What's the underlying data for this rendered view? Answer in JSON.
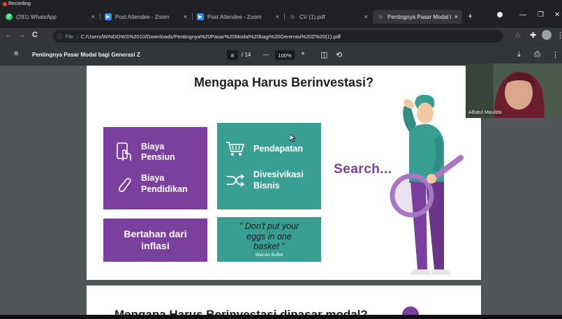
{
  "recording": {
    "label": "Recording"
  },
  "tabs": [
    {
      "title": "(281) WhatsApp",
      "icon": "whatsapp-icon",
      "color": "#25d366",
      "close": "×"
    },
    {
      "title": "Post Attendee - Zoom",
      "icon": "zoom-icon",
      "color": "#2d8cff",
      "close": "×"
    },
    {
      "title": "Post Attendee - Zoom",
      "icon": "zoom-icon",
      "color": "#2d8cff",
      "close": "×"
    },
    {
      "title": "CV (1).pdf",
      "icon": "globe-icon",
      "color": "#9aa0a6",
      "close": "×"
    },
    {
      "title": "Pentingnya Pasar Modal bag",
      "icon": "globe-icon",
      "color": "#9aa0a6",
      "close": "×"
    }
  ],
  "new_tab": "+",
  "address": {
    "file_label": "File",
    "url": "C:/Users/WINDOWS%2010/Downloads/Pentingnya%20Pasar%20Modal%20bagi%20Generasi%20Z%20(1).pdf"
  },
  "pdf_toolbar": {
    "title": "Pentingnya Pasar Modal bagi Generasi Z",
    "page": "8",
    "total": "/ 14",
    "zoom": "100%",
    "minus": "—",
    "plus": "+"
  },
  "slide": {
    "title": "Mengapa Harus Berinvestasi?",
    "card1": {
      "line1": "Biaya\nPensiun",
      "line2": "Biaya\nPendidikan"
    },
    "card2": {
      "line1": "Pendapatan",
      "line2": "Divesivikasi\nBisnis"
    },
    "card3": {
      "text": "Bertahan dari\ninflasi"
    },
    "card4": {
      "quote": "\" Don't put your\neggs in one\nbasket \"",
      "author": "Warren Buffet"
    },
    "search": "Search..."
  },
  "next_slide": {
    "title": "Mengapa Harus Berinvestasi dipasar modal?"
  },
  "webcam": {
    "name": "Alfiatul Maulida"
  },
  "colors": {
    "purple": "#7b3f9e",
    "teal": "#3a9f93"
  }
}
